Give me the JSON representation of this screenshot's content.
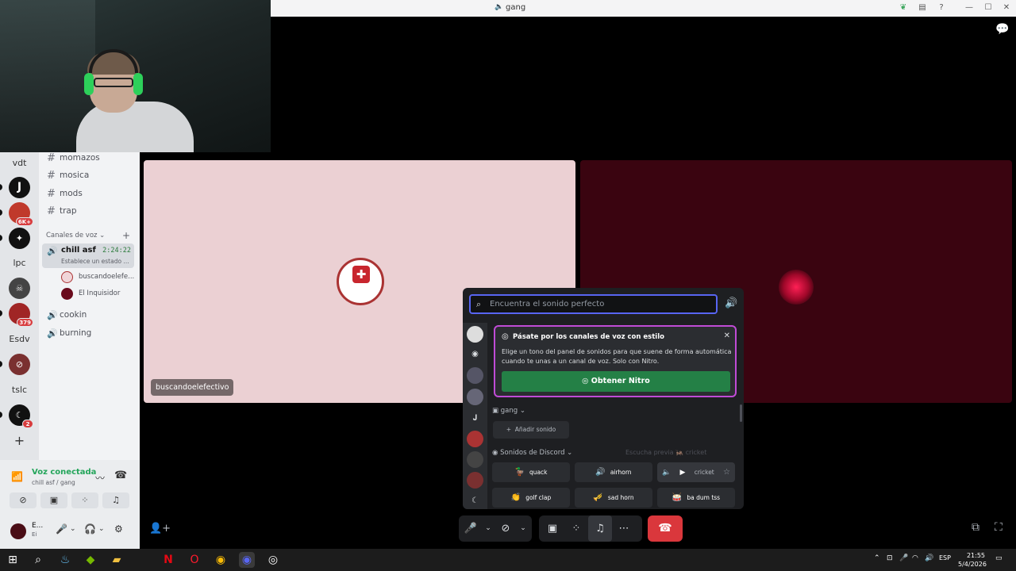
{
  "titlebar": {
    "title": "gang",
    "minimize": "—",
    "maximize": "☐",
    "close": "✕"
  },
  "servers": {
    "items": [
      {
        "label": "vdt",
        "badge": ""
      },
      {
        "label": "J",
        "badge": ""
      },
      {
        "label": "",
        "badge": "6K+"
      },
      {
        "label": "",
        "badge": ""
      },
      {
        "label": "lpc",
        "badge": ""
      },
      {
        "label": "",
        "badge": ""
      },
      {
        "label": "",
        "badge": "379"
      },
      {
        "label": "Esdv",
        "badge": ""
      },
      {
        "label": "",
        "badge": ""
      },
      {
        "label": "tslc",
        "badge": ""
      },
      {
        "label": "",
        "badge": "2"
      },
      {
        "label": "+",
        "badge": ""
      }
    ]
  },
  "channels": {
    "text": [
      "momazos",
      "mosica",
      "mods",
      "trap"
    ],
    "voice_header": "Canales de voz",
    "active_voice": {
      "name": "chill asf",
      "time": "2:24:22",
      "status": "Establece un estado ..."
    },
    "voice_users": [
      "buscandoelefe...",
      "El Inquisidor"
    ],
    "voice_channels": [
      "cookin",
      "burning"
    ]
  },
  "user_panel": {
    "status": "Voz conectada",
    "sub": "chill asf / gang",
    "username": "E...",
    "user_sub": "Ei"
  },
  "tiles": {
    "tile1_label": "buscandoelefectivo"
  },
  "soundboard": {
    "search_placeholder": "Encuentra el sonido perfecto",
    "nitro_title": "Pásate por los canales de voz con estilo",
    "nitro_desc": "Elige un tono del panel de sonidos para que suene de forma automática cuando te unas a un canal de voz. Solo con Nitro.",
    "nitro_button": "Obtener Nitro",
    "gang_label": "gang",
    "add_sound": "Añadir sonido",
    "discord_sounds": "Sonidos de Discord",
    "preview": "Escucha previa",
    "preview_sound": "cricket",
    "sounds": [
      {
        "name": "quack",
        "emoji": "🦆"
      },
      {
        "name": "airhorn",
        "emoji": "🔊"
      },
      {
        "name": "cricket",
        "emoji": "🦗"
      },
      {
        "name": "golf clap",
        "emoji": "👏"
      },
      {
        "name": "sad horn",
        "emoji": "🎺"
      },
      {
        "name": "ba dum tss",
        "emoji": "🥁"
      }
    ]
  },
  "taskbar": {
    "time": "21:55",
    "date": "5/4/2026",
    "lang": "ESP"
  },
  "colors": {
    "accent": "#5865f2",
    "green": "#23a55a",
    "danger": "#da373c",
    "nitro_border": "#c04bd6"
  }
}
